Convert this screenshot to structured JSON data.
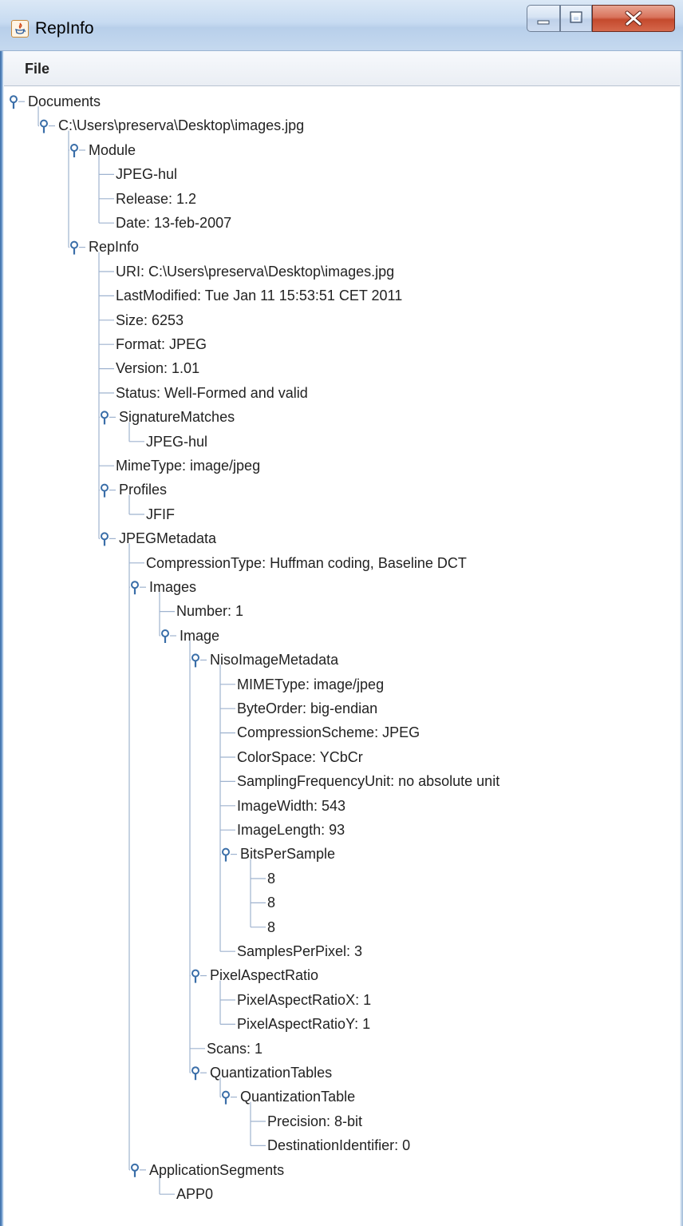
{
  "window": {
    "title": "RepInfo"
  },
  "menu": {
    "items": [
      "File"
    ]
  },
  "colors": {
    "tree_line": "#9fb3cf",
    "handle": "#3a6ea8"
  },
  "tree": [
    {
      "label": "Documents",
      "depth": 0,
      "expanded": true
    },
    {
      "label": "C:\\Users\\preserva\\Desktop\\images.jpg",
      "depth": 1,
      "expanded": true
    },
    {
      "label": "Module",
      "depth": 2,
      "expanded": true
    },
    {
      "label": "JPEG-hul",
      "depth": 3
    },
    {
      "label": "Release: 1.2",
      "depth": 3
    },
    {
      "label": "Date: 13-feb-2007",
      "depth": 3
    },
    {
      "label": "RepInfo",
      "depth": 2,
      "expanded": true
    },
    {
      "label": "URI: C:\\Users\\preserva\\Desktop\\images.jpg",
      "depth": 3
    },
    {
      "label": "LastModified: Tue Jan 11 15:53:51 CET 2011",
      "depth": 3
    },
    {
      "label": "Size: 6253",
      "depth": 3
    },
    {
      "label": "Format: JPEG",
      "depth": 3
    },
    {
      "label": "Version: 1.01",
      "depth": 3
    },
    {
      "label": "Status: Well-Formed and valid",
      "depth": 3
    },
    {
      "label": "SignatureMatches",
      "depth": 3,
      "expanded": true
    },
    {
      "label": "JPEG-hul",
      "depth": 4
    },
    {
      "label": "MimeType: image/jpeg",
      "depth": 3
    },
    {
      "label": "Profiles",
      "depth": 3,
      "expanded": true
    },
    {
      "label": "JFIF",
      "depth": 4
    },
    {
      "label": "JPEGMetadata",
      "depth": 3,
      "expanded": true
    },
    {
      "label": "CompressionType: Huffman coding, Baseline DCT",
      "depth": 4
    },
    {
      "label": "Images",
      "depth": 4,
      "expanded": true
    },
    {
      "label": "Number: 1",
      "depth": 5
    },
    {
      "label": "Image",
      "depth": 5,
      "expanded": true
    },
    {
      "label": "NisoImageMetadata",
      "depth": 6,
      "expanded": true
    },
    {
      "label": "MIMEType: image/jpeg",
      "depth": 7
    },
    {
      "label": "ByteOrder: big-endian",
      "depth": 7
    },
    {
      "label": "CompressionScheme: JPEG",
      "depth": 7
    },
    {
      "label": "ColorSpace: YCbCr",
      "depth": 7
    },
    {
      "label": "SamplingFrequencyUnit: no absolute unit",
      "depth": 7
    },
    {
      "label": "ImageWidth: 543",
      "depth": 7
    },
    {
      "label": "ImageLength: 93",
      "depth": 7
    },
    {
      "label": "BitsPerSample",
      "depth": 7,
      "expanded": true
    },
    {
      "label": "8",
      "depth": 8
    },
    {
      "label": "8",
      "depth": 8
    },
    {
      "label": "8",
      "depth": 8
    },
    {
      "label": "SamplesPerPixel: 3",
      "depth": 7
    },
    {
      "label": "PixelAspectRatio",
      "depth": 6,
      "expanded": true
    },
    {
      "label": "PixelAspectRatioX: 1",
      "depth": 7
    },
    {
      "label": "PixelAspectRatioY: 1",
      "depth": 7
    },
    {
      "label": "Scans: 1",
      "depth": 6
    },
    {
      "label": "QuantizationTables",
      "depth": 6,
      "expanded": true
    },
    {
      "label": "QuantizationTable",
      "depth": 7,
      "expanded": true
    },
    {
      "label": "Precision: 8-bit",
      "depth": 8
    },
    {
      "label": "DestinationIdentifier: 0",
      "depth": 8
    },
    {
      "label": "ApplicationSegments",
      "depth": 4,
      "expanded": true
    },
    {
      "label": "APP0",
      "depth": 5
    }
  ]
}
